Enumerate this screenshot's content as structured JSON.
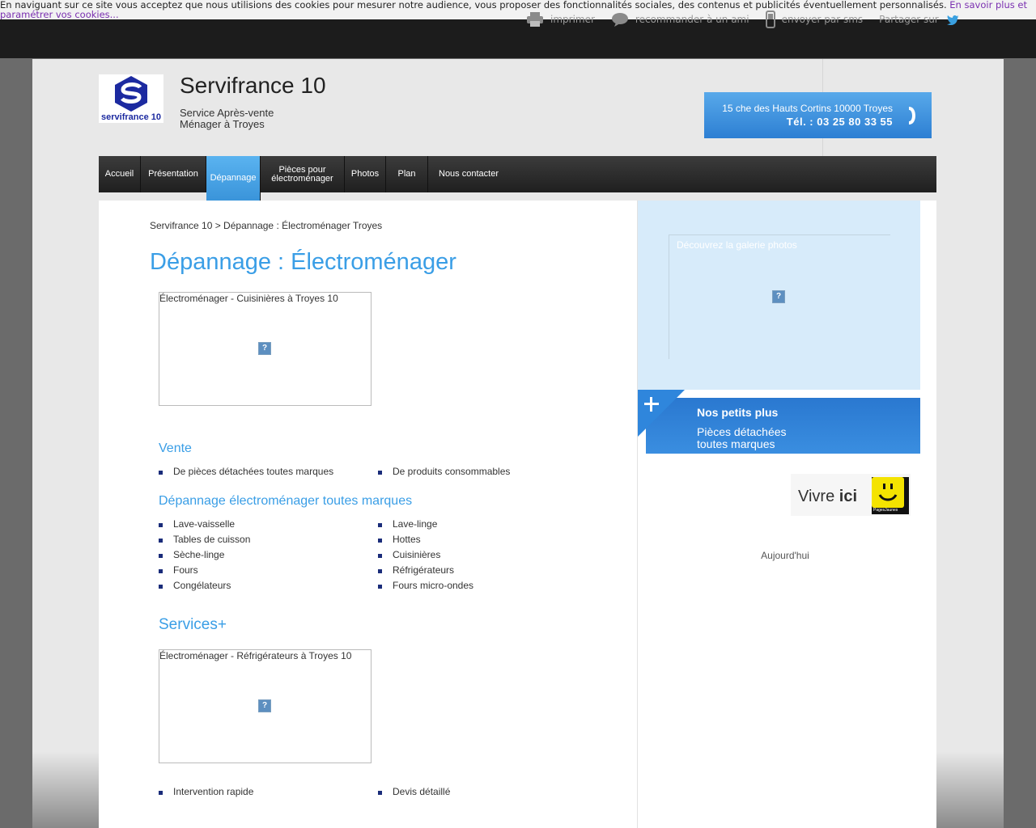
{
  "cookie": {
    "text": "En naviguant sur ce site vous acceptez que nous utilisions des cookies pour mesurer notre audience, vous proposer des fonctionnalités sociales, des contenus et publicités éventuellement personnalisés.",
    "link": "En savoir plus et paramétrer vos cookies..."
  },
  "toolbar": {
    "print": "imprimer",
    "recommend": "recommander à un ami",
    "sms": "envoyer par sms",
    "share": "Partager sur"
  },
  "header": {
    "logo_text": "servifrance 10",
    "title": "Servifrance 10",
    "subtitle_1": "Service Après-vente",
    "subtitle_2": "Ménager à Troyes",
    "address": "15 che des Hauts Cortins 10000 Troyes",
    "phone": "Tél. : 03 25 80 33 55"
  },
  "nav": {
    "items": [
      "Accueil",
      "Présentation",
      "Dépannage",
      "Pièces pour",
      "électroménager",
      "Photos",
      "Plan",
      "Nous contacter"
    ]
  },
  "content": {
    "breadcrumb": "Servifrance 10 > Dépannage : Électroménager Troyes",
    "title": "Dépannage : Électroménager",
    "image1_caption": "Électroménager - Cuisinières à Troyes 10",
    "vente_title": "Vente",
    "vente_left": [
      "De pièces détachées toutes marques"
    ],
    "vente_right": [
      "De produits consommables"
    ],
    "depannage_title": "Dépannage électroménager toutes marques",
    "depannage_left": [
      "Lave-vaisselle",
      "Tables de cuisson",
      "Sèche-linge",
      "Fours",
      "Congélateurs"
    ],
    "depannage_right": [
      "Lave-linge",
      "Hottes",
      "Cuisinières",
      "Réfrigérateurs",
      "Fours micro-ondes"
    ],
    "services_title": "Services+",
    "image2_caption": "Électroménager - Réfrigérateurs à Troyes 10",
    "services_left": [
      "Intervention rapide"
    ],
    "services_right": [
      "Devis détaillé"
    ]
  },
  "sidebar": {
    "gallery_caption": "Découvrez la galerie photos",
    "plus_title": "Nos petits plus",
    "plus_line_1": "Pièces détachées",
    "plus_line_2": "toutes marques",
    "vivre": "Vivre",
    "vivre_bold": "ici",
    "pj_label": "PagesJaunes",
    "today": "Aujourd'hui"
  },
  "colors": {
    "accent": "#3a9ee6",
    "nav_active": "#4aa6e8",
    "topbar": "#1c1c1c",
    "link_purple": "#7a2fb0"
  }
}
